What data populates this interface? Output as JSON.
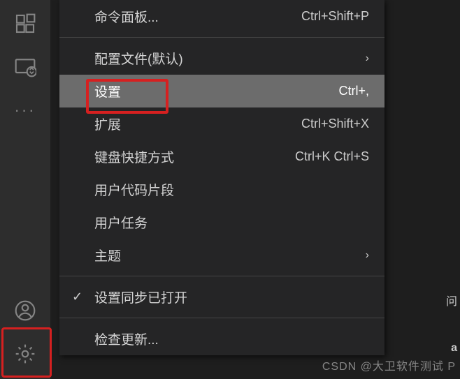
{
  "activity": {
    "extensions": "extensions-icon",
    "remote": "remote-explorer-icon",
    "dots": "···",
    "account": "accounts-icon",
    "gear": "settings-gear-icon"
  },
  "menu": {
    "command_palette": {
      "label": "命令面板...",
      "shortcut": "Ctrl+Shift+P"
    },
    "profiles": {
      "label": "配置文件(默认)"
    },
    "settings": {
      "label": "设置",
      "shortcut": "Ctrl+,"
    },
    "extensions": {
      "label": "扩展",
      "shortcut": "Ctrl+Shift+X"
    },
    "keyboard": {
      "label": "键盘快捷方式",
      "shortcut": "Ctrl+K Ctrl+S"
    },
    "snippets": {
      "label": "用户代码片段"
    },
    "tasks": {
      "label": "用户任务"
    },
    "themes": {
      "label": "主题"
    },
    "sync": {
      "label": "设置同步已打开"
    },
    "updates": {
      "label": "检查更新..."
    }
  },
  "edge": {
    "t1": "问",
    "t2": "a"
  },
  "watermark": "CSDN @大卫软件测试 P"
}
